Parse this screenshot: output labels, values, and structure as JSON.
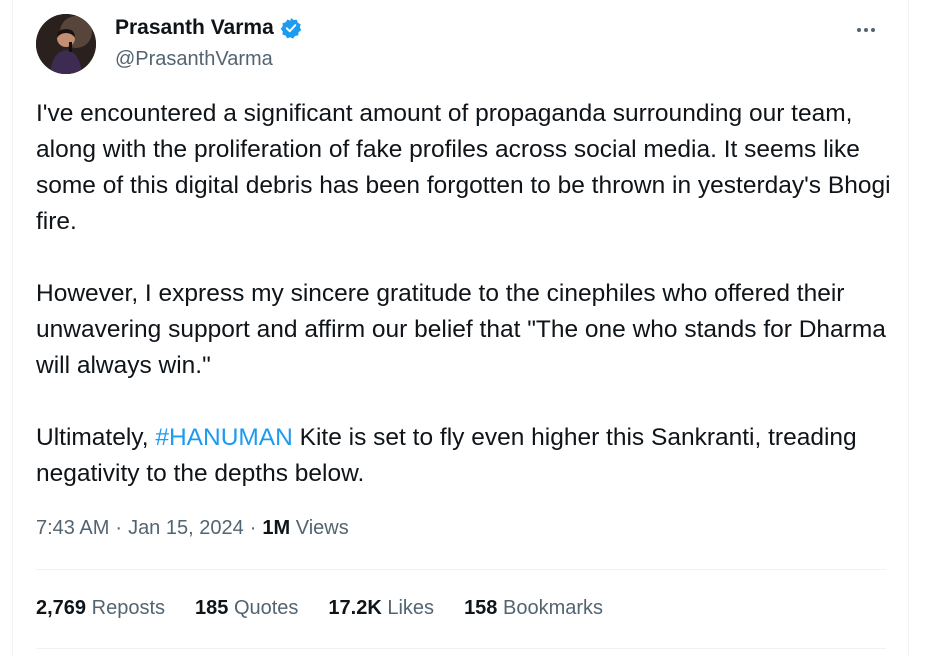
{
  "author": {
    "display_name": "Prasanth Varma",
    "handle": "@PrasanthVarma",
    "verified": true
  },
  "tweet": {
    "para1": "I've encountered a significant amount of propaganda surrounding our team, along with the proliferation of fake profiles across social media. It seems like some of this digital debris has been forgotten to be thrown in yesterday's Bhogi fire.",
    "para2": "However, I express my sincere gratitude to the cinephiles who offered their unwavering support and affirm our belief that \"The one who stands for Dharma will always win.\"",
    "para3_prefix": "Ultimately, ",
    "hashtag": "#HANUMAN",
    "para3_suffix": " Kite is set to fly even higher this Sankranti, treading negativity to the depths below."
  },
  "meta": {
    "time": "7:43 AM",
    "separator": "·",
    "date": "Jan 15, 2024",
    "views_count": "1M",
    "views_label": "Views"
  },
  "stats": [
    {
      "count": "2,769",
      "label": "Reposts"
    },
    {
      "count": "185",
      "label": "Quotes"
    },
    {
      "count": "17.2K",
      "label": "Likes"
    },
    {
      "count": "158",
      "label": "Bookmarks"
    }
  ],
  "colors": {
    "accent": "#1d9bf0",
    "text": "#0f1419",
    "secondary": "#536471",
    "divider": "#eff3f4"
  },
  "icons": {
    "verified": "verified-badge-icon",
    "more": "more-horizontal-icon"
  }
}
